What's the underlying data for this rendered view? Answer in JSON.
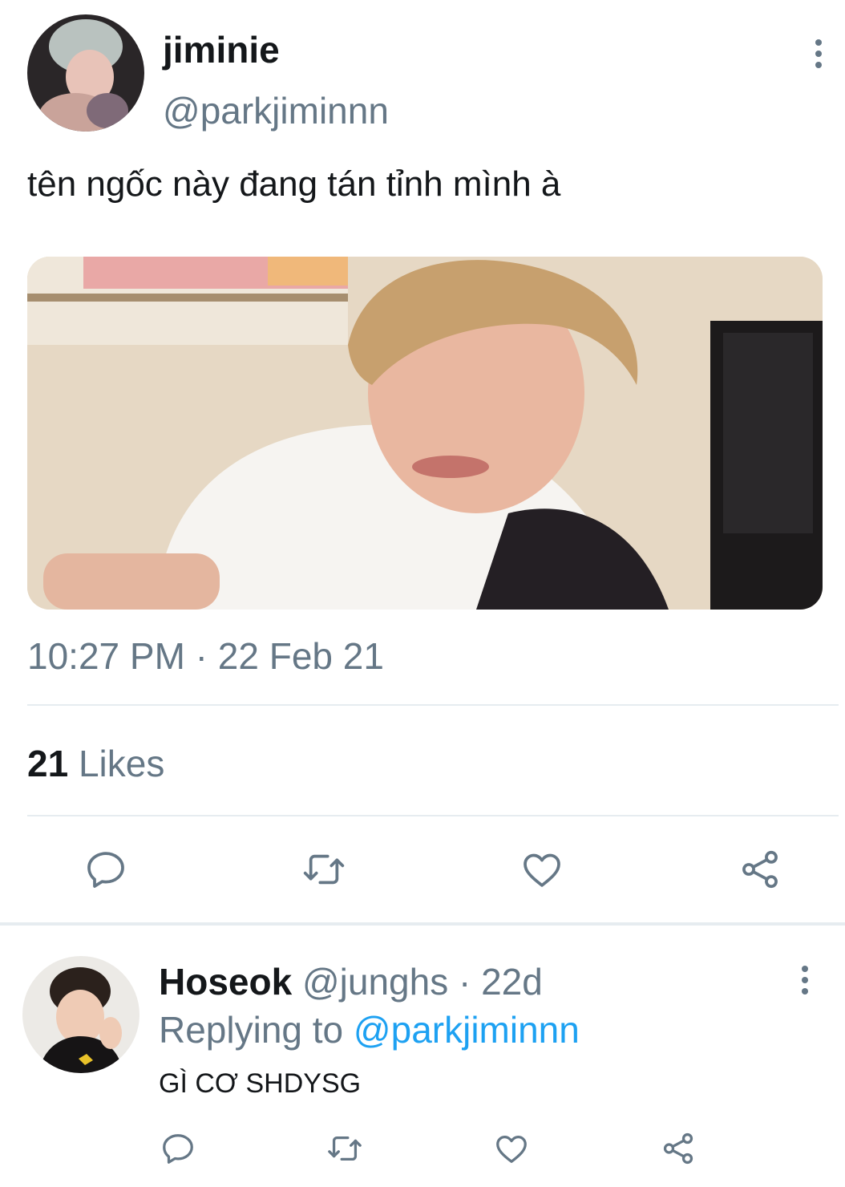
{
  "tweet": {
    "author": {
      "display_name": "jiminie",
      "handle": "@parkjiminnn"
    },
    "text": "tên ngốc này đang tán tỉnh mình à",
    "media": {
      "icon": "photo-image"
    },
    "timestamp": {
      "time": "10:27 PM",
      "separator": " · ",
      "date": "22 Feb 21"
    },
    "stats": {
      "likes_count": "21",
      "likes_label": "Likes"
    },
    "actions": [
      "reply-icon",
      "retweet-icon",
      "like-icon",
      "share-icon"
    ],
    "more_icon": "more-vertical-icon"
  },
  "reply": {
    "author": {
      "display_name": "Hoseok",
      "handle": "@junghs",
      "separator": " · ",
      "age": "22d"
    },
    "replying_prefix": "Replying to ",
    "replying_to": "@parkjiminnn",
    "text": "GÌ CƠ SHDYSG",
    "actions": [
      "reply-icon",
      "retweet-icon",
      "like-icon",
      "share-icon"
    ],
    "more_icon": "more-vertical-icon"
  },
  "colors": {
    "accent": "#1da1f2",
    "muted": "#657786",
    "text": "#14171a",
    "divider": "#e6ecf0"
  }
}
